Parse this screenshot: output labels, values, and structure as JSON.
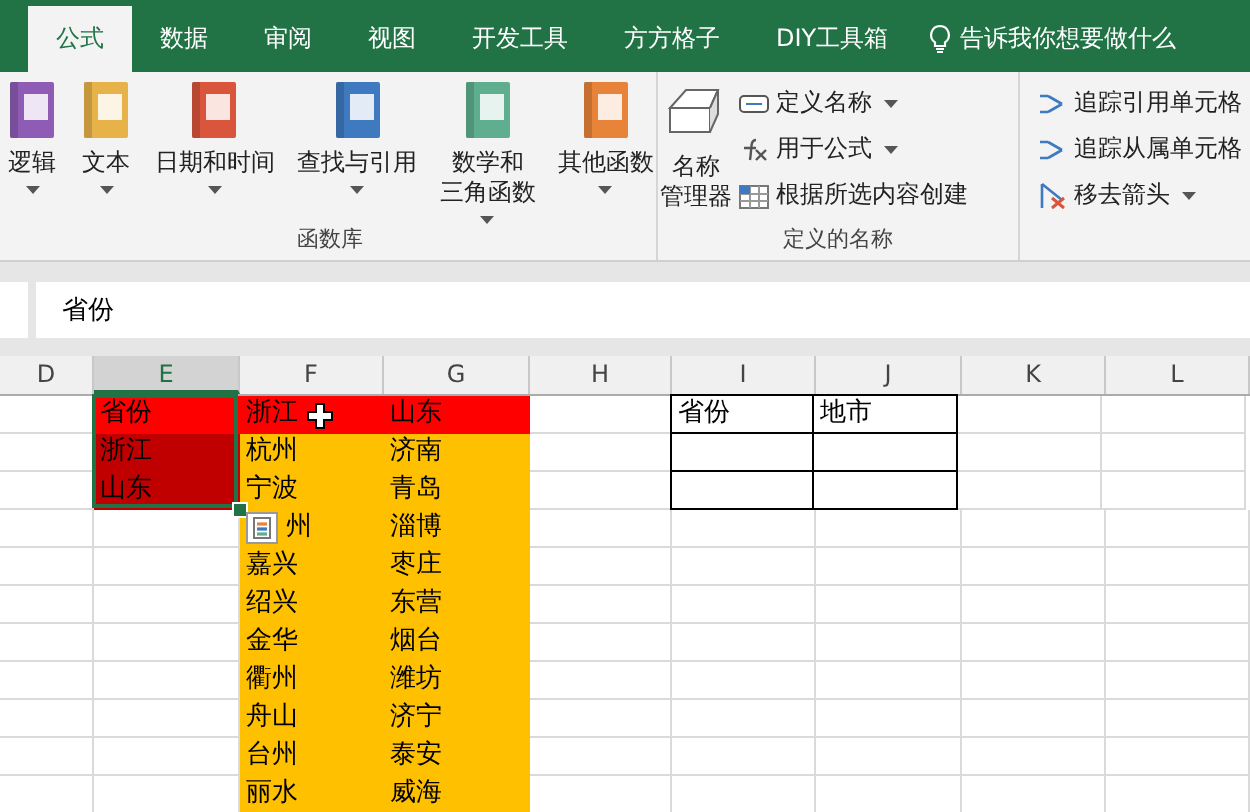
{
  "tabs": [
    {
      "label": "公式",
      "selected": true
    },
    {
      "label": "数据",
      "selected": false
    },
    {
      "label": "审阅",
      "selected": false
    },
    {
      "label": "视图",
      "selected": false
    },
    {
      "label": "开发工具",
      "selected": false
    },
    {
      "label": "方方格子",
      "selected": false
    },
    {
      "label": "DIY工具箱",
      "selected": false
    }
  ],
  "tell_me": "告诉我你想要做什么",
  "ribbon": {
    "groups": [
      {
        "label": "函数库",
        "buttons": [
          {
            "lines": [
              "逻辑"
            ],
            "kind": "logic",
            "dropdown": true
          },
          {
            "lines": [
              "文本"
            ],
            "kind": "text",
            "dropdown": true
          },
          {
            "lines": [
              "日期和时间"
            ],
            "kind": "date",
            "dropdown": true
          },
          {
            "lines": [
              "查找与引用"
            ],
            "kind": "lookup",
            "dropdown": true
          },
          {
            "lines": [
              "数学和",
              "三角函数"
            ],
            "kind": "math",
            "dropdown": true
          },
          {
            "lines": [
              "其他函数"
            ],
            "kind": "more",
            "dropdown": true
          }
        ]
      },
      {
        "label": "定义的名称",
        "big": {
          "lines": [
            "名称",
            "管理器"
          ]
        },
        "items": [
          {
            "label": "定义名称",
            "kind": "define",
            "dropdown": true
          },
          {
            "label": "用于公式",
            "kind": "use",
            "dropdown": true
          },
          {
            "label": "根据所选内容创建",
            "kind": "create",
            "dropdown": false
          }
        ]
      },
      {
        "items": [
          {
            "label": "追踪引用单元格",
            "kind": "precedents",
            "dropdown": false
          },
          {
            "label": "追踪从属单元格",
            "kind": "dependents",
            "dropdown": false
          },
          {
            "label": "移去箭头",
            "kind": "remove",
            "dropdown": true
          }
        ]
      }
    ]
  },
  "formula_bar": {
    "value": "省份"
  },
  "sheet": {
    "columns": [
      {
        "label": "D",
        "selected": false
      },
      {
        "label": "E",
        "selected": true
      },
      {
        "label": "F",
        "selected": false
      },
      {
        "label": "G",
        "selected": false
      },
      {
        "label": "H",
        "selected": false
      },
      {
        "label": "I",
        "selected": false
      },
      {
        "label": "J",
        "selected": false
      },
      {
        "label": "K",
        "selected": false
      },
      {
        "label": "L",
        "selected": false
      }
    ],
    "rows": [
      [
        {},
        {
          "text": "省份",
          "kind": "red"
        },
        {
          "text": "浙江",
          "kind": "red"
        },
        {
          "text": "山东",
          "kind": "red"
        },
        {},
        {
          "text": "省份",
          "kind": "boxed"
        },
        {
          "text": "地市",
          "kind": "boxed"
        },
        {},
        {}
      ],
      [
        {},
        {
          "text": "浙江",
          "kind": "shaded"
        },
        {
          "text": "杭州",
          "kind": "amber"
        },
        {
          "text": "济南",
          "kind": "amber"
        },
        {},
        {
          "kind": "boxed"
        },
        {
          "kind": "boxed"
        },
        {},
        {}
      ],
      [
        {},
        {
          "text": "山东",
          "kind": "shaded"
        },
        {
          "text": "宁波",
          "kind": "amber"
        },
        {
          "text": "青岛",
          "kind": "amber"
        },
        {},
        {
          "kind": "boxed"
        },
        {
          "kind": "boxed"
        },
        {},
        {}
      ],
      [
        {},
        {},
        {
          "text": "州",
          "kind": "amber",
          "indent": true
        },
        {
          "text": "淄博",
          "kind": "amber"
        },
        {},
        {},
        {},
        {},
        {}
      ],
      [
        {},
        {},
        {
          "text": "嘉兴",
          "kind": "amber"
        },
        {
          "text": "枣庄",
          "kind": "amber"
        },
        {},
        {},
        {},
        {},
        {}
      ],
      [
        {},
        {},
        {
          "text": "绍兴",
          "kind": "amber"
        },
        {
          "text": "东营",
          "kind": "amber"
        },
        {},
        {},
        {},
        {},
        {}
      ],
      [
        {},
        {},
        {
          "text": "金华",
          "kind": "amber"
        },
        {
          "text": "烟台",
          "kind": "amber"
        },
        {},
        {},
        {},
        {},
        {}
      ],
      [
        {},
        {},
        {
          "text": "衢州",
          "kind": "amber"
        },
        {
          "text": "潍坊",
          "kind": "amber"
        },
        {},
        {},
        {},
        {},
        {}
      ],
      [
        {},
        {},
        {
          "text": "舟山",
          "kind": "amber"
        },
        {
          "text": "济宁",
          "kind": "amber"
        },
        {},
        {},
        {},
        {},
        {}
      ],
      [
        {},
        {},
        {
          "text": "台州",
          "kind": "amber"
        },
        {
          "text": "泰安",
          "kind": "amber"
        },
        {},
        {},
        {},
        {},
        {}
      ],
      [
        {},
        {},
        {
          "text": "丽水",
          "kind": "amber"
        },
        {
          "text": "威海",
          "kind": "amber"
        },
        {},
        {},
        {},
        {},
        {}
      ]
    ]
  }
}
